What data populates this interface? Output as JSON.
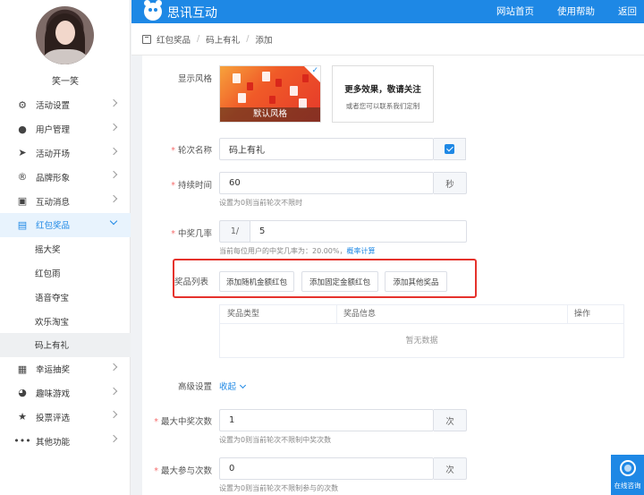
{
  "user": {
    "name": "笑一笑"
  },
  "topbar": {
    "brand": "思讯互动",
    "links": [
      "网站首页",
      "使用帮助",
      "返回"
    ]
  },
  "breadcrumb": [
    "红包奖品",
    "码上有礼",
    "添加"
  ],
  "menu": [
    {
      "label": "活动设置",
      "icon": "gear-icon"
    },
    {
      "label": "用户管理",
      "icon": "user-icon"
    },
    {
      "label": "活动开场",
      "icon": "send-icon"
    },
    {
      "label": "品牌形象",
      "icon": "registered-icon"
    },
    {
      "label": "互动消息",
      "icon": "message-icon"
    },
    {
      "label": "红包奖品",
      "icon": "red-packet-icon",
      "active": true
    },
    {
      "label": "幸运抽奖",
      "icon": "lottery-icon"
    },
    {
      "label": "趣味游戏",
      "icon": "game-icon"
    },
    {
      "label": "投票评选",
      "icon": "star-icon"
    },
    {
      "label": "其他功能",
      "icon": "more-icon"
    }
  ],
  "submenu": [
    "摇大奖",
    "红包雨",
    "语音夺宝",
    "欢乐淘宝",
    "码上有礼"
  ],
  "form": {
    "style_label": "显示风格",
    "style_card_label": "默认风格",
    "more_title": "更多效果，敬请关注",
    "more_sub": "或者您可以联系我们定制",
    "round_name_label": "轮次名称",
    "round_name_value": "码上有礼",
    "duration_label": "持续时间",
    "duration_value": "60",
    "duration_unit": "秒",
    "duration_hint": "设置为0则当前轮次不限时",
    "rate_label": "中奖几率",
    "rate_prefix": "1/",
    "rate_value": "5",
    "rate_hint": "当前每位用户的中奖几率为：20.00%，",
    "rate_hint_link": "概率计算",
    "prize_label": "奖品列表",
    "prize_buttons": [
      "添加随机金额红包",
      "添加固定金额红包",
      "添加其他奖品"
    ],
    "table_headers": [
      "奖品类型",
      "奖品信息",
      "操作"
    ],
    "table_empty": "暂无数据",
    "advanced_label": "高级设置",
    "collapse_label": "收起",
    "max_win_label": "最大中奖次数",
    "max_win_value": "1",
    "max_win_unit": "次",
    "max_win_hint": "设置为0则当前轮次不限制中奖次数",
    "max_join_label": "最大参与次数",
    "max_join_value": "0",
    "max_join_unit": "次",
    "max_join_hint": "设置为0则当前轮次不限制参与的次数"
  },
  "service": {
    "label": "在线咨询"
  },
  "colors": {
    "primary": "#1e88e5",
    "highlight_border": "#e5322c",
    "required": "#f56c6c"
  }
}
